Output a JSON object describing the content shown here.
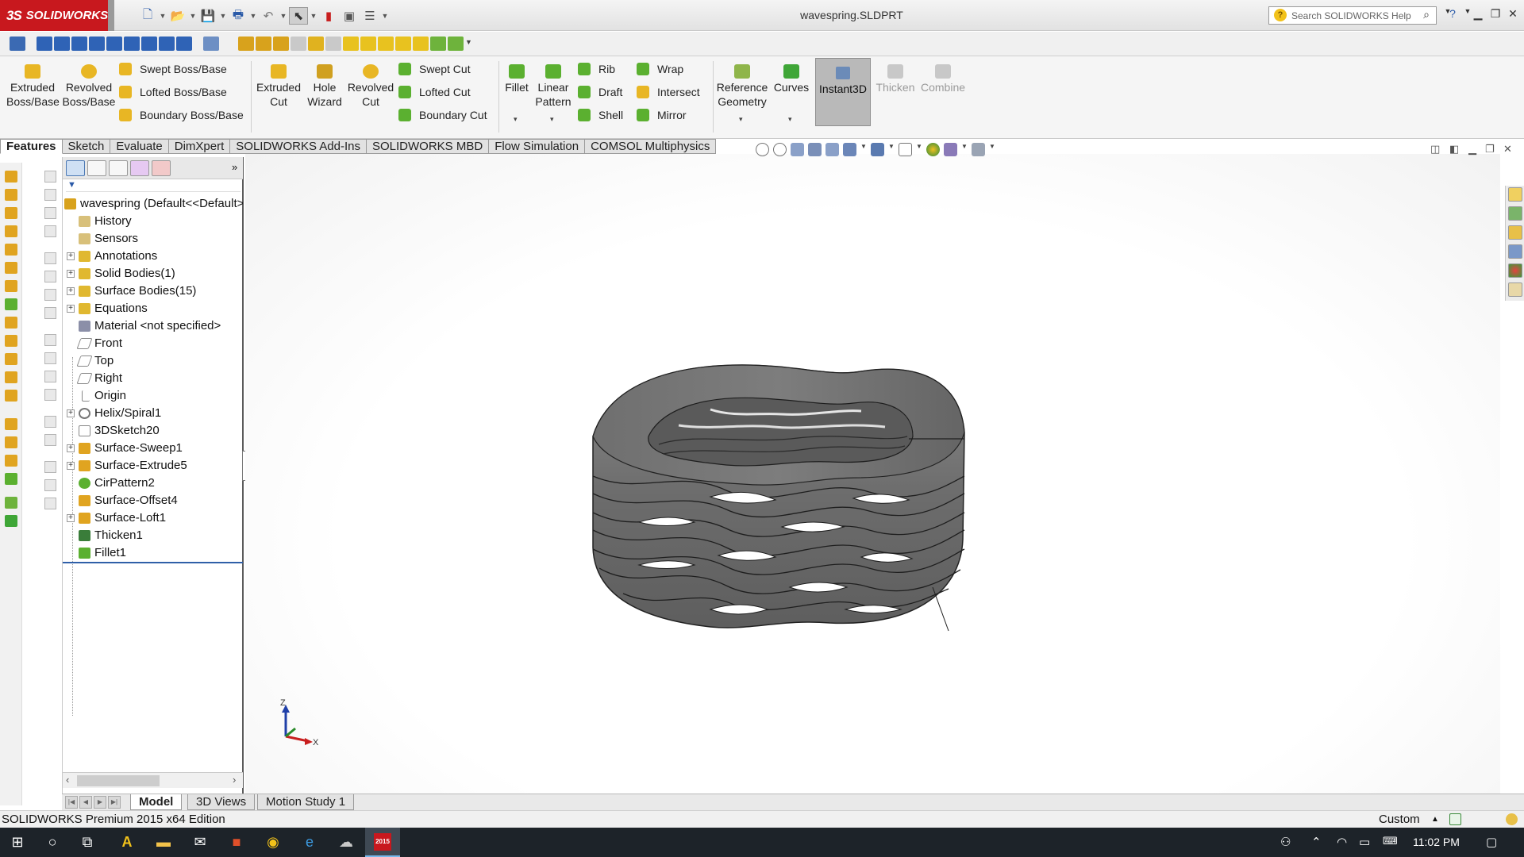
{
  "app": {
    "logo_text": "SOLIDWORKS",
    "document_title": "wavespring.SLDPRT",
    "help_search_placeholder": "Search SOLIDWORKS Help"
  },
  "command_manager": {
    "extruded_boss": "Extruded Boss/Base",
    "revolved_boss": "Revolved Boss/Base",
    "swept_boss": "Swept Boss/Base",
    "lofted_boss": "Lofted Boss/Base",
    "boundary_boss": "Boundary Boss/Base",
    "extruded_cut": "Extruded Cut",
    "hole_wizard": "Hole Wizard",
    "revolved_cut": "Revolved Cut",
    "swept_cut": "Swept Cut",
    "lofted_cut": "Lofted Cut",
    "boundary_cut": "Boundary Cut",
    "fillet": "Fillet",
    "linear_pattern": "Linear Pattern",
    "rib": "Rib",
    "draft": "Draft",
    "shell": "Shell",
    "wrap": "Wrap",
    "intersect": "Intersect",
    "mirror": "Mirror",
    "reference_geometry": "Reference Geometry",
    "curves": "Curves",
    "instant3d": "Instant3D",
    "thicken": "Thicken",
    "combine": "Combine"
  },
  "tabs": [
    "Features",
    "Sketch",
    "Evaluate",
    "DimXpert",
    "SOLIDWORKS Add-Ins",
    "SOLIDWORKS MBD",
    "Flow Simulation",
    "COMSOL Multiphysics"
  ],
  "feature_tree": {
    "root": "wavespring  (Default<<Default>",
    "items": [
      "History",
      "Sensors",
      "Annotations",
      "Solid Bodies(1)",
      "Surface Bodies(15)",
      "Equations",
      "Material <not specified>",
      "Front",
      "Top",
      "Right",
      "Origin",
      "Helix/Spiral1",
      "3DSketch20",
      "Surface-Sweep1",
      "Surface-Extrude5",
      "CirPattern2",
      "Surface-Offset4",
      "Surface-Loft1",
      "Thicken1",
      "Fillet1"
    ]
  },
  "triad": {
    "z": "Z",
    "x": "X"
  },
  "bottom_tabs": [
    "Model",
    "3D Views",
    "Motion Study 1"
  ],
  "status": {
    "text": "SOLIDWORKS Premium 2015 x64 Edition",
    "units": "Custom"
  },
  "taskbar": {
    "clock": "11:02 PM",
    "sw_badge": "2015"
  },
  "colors": {
    "brand_red": "#c8181e",
    "model_gray": "#707070",
    "taskbar": "#1d2329"
  }
}
